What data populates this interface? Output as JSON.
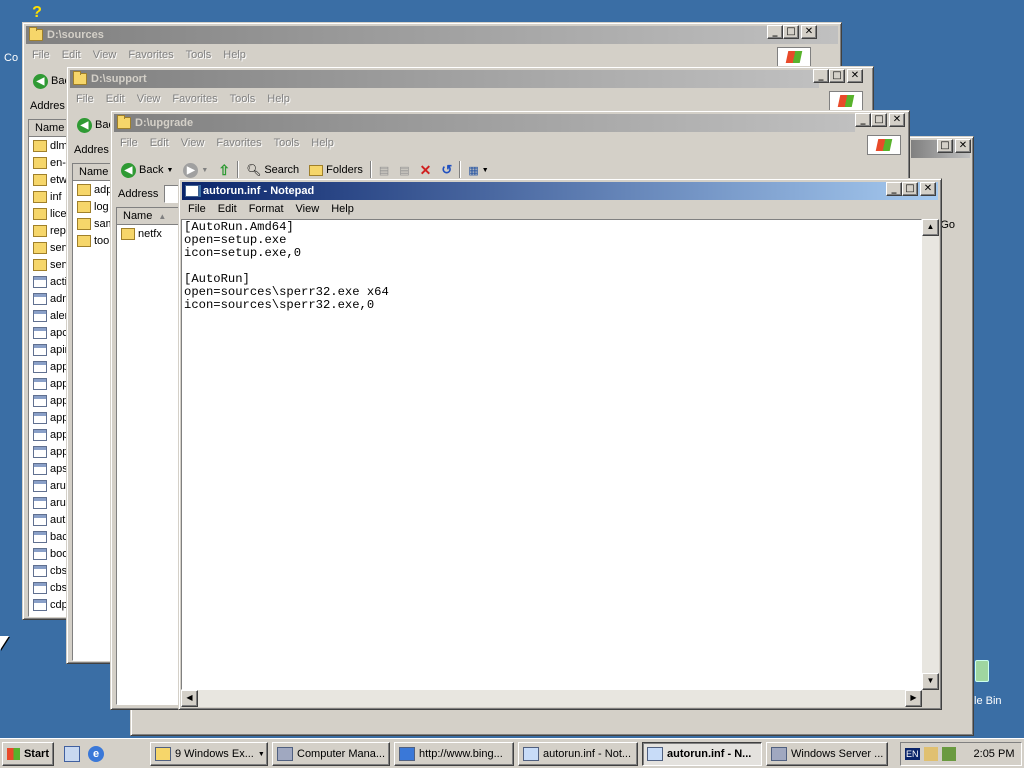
{
  "desktop": {
    "recycle_bin_label": "le Bin",
    "computer_label_fragment": "Co"
  },
  "win_sources": {
    "title": "D:\\sources",
    "menu": [
      "File",
      "Edit",
      "View",
      "Favorites",
      "Tools",
      "Help"
    ],
    "back_label": "Bac",
    "address_label": "Addres",
    "column_name": "Name",
    "files": [
      {
        "name": "dlm",
        "kind": "folder"
      },
      {
        "name": "en-",
        "kind": "folder"
      },
      {
        "name": "etw",
        "kind": "folder"
      },
      {
        "name": "inf",
        "kind": "folder"
      },
      {
        "name": "licer",
        "kind": "folder"
      },
      {
        "name": "rep",
        "kind": "folder"
      },
      {
        "name": "serv",
        "kind": "folder"
      },
      {
        "name": "serv",
        "kind": "folder"
      },
      {
        "name": "acti",
        "kind": "doc"
      },
      {
        "name": "adm",
        "kind": "doc"
      },
      {
        "name": "aler",
        "kind": "doc"
      },
      {
        "name": "apc",
        "kind": "doc"
      },
      {
        "name": "apir",
        "kind": "doc"
      },
      {
        "name": "app",
        "kind": "doc"
      },
      {
        "name": "app",
        "kind": "doc"
      },
      {
        "name": "app",
        "kind": "doc"
      },
      {
        "name": "app",
        "kind": "doc"
      },
      {
        "name": "app",
        "kind": "doc"
      },
      {
        "name": "app",
        "kind": "doc"
      },
      {
        "name": "aps",
        "kind": "doc"
      },
      {
        "name": "aru",
        "kind": "doc"
      },
      {
        "name": "aru",
        "kind": "doc"
      },
      {
        "name": "aut",
        "kind": "doc"
      },
      {
        "name": "bac",
        "kind": "doc"
      },
      {
        "name": "boo",
        "kind": "doc"
      },
      {
        "name": "cbs",
        "kind": "doc"
      },
      {
        "name": "cbs",
        "kind": "doc"
      },
      {
        "name": "cdp",
        "kind": "doc"
      }
    ]
  },
  "win_support": {
    "title": "D:\\support",
    "menu": [
      "File",
      "Edit",
      "View",
      "Favorites",
      "Tools",
      "Help"
    ],
    "back_label": "Bac",
    "address_label": "Addres",
    "column_name": "Name",
    "files": [
      {
        "name": "adp",
        "kind": "folder"
      },
      {
        "name": "log",
        "kind": "folder"
      },
      {
        "name": "sam",
        "kind": "folder"
      },
      {
        "name": "too",
        "kind": "folder"
      }
    ]
  },
  "win_upgrade": {
    "title": "D:\\upgrade",
    "menu": [
      "File",
      "Edit",
      "View",
      "Favorites",
      "Tools",
      "Help"
    ],
    "back_label": "Back",
    "search_label": "Search",
    "folders_label": "Folders",
    "address_label": "Address",
    "column_name": "Name",
    "files": [
      {
        "name": "netfx",
        "kind": "folder"
      }
    ]
  },
  "win_back": {
    "go_label": "Go"
  },
  "notepad": {
    "title": "autorun.inf - Notepad",
    "menu": [
      "File",
      "Edit",
      "Format",
      "View",
      "Help"
    ],
    "lines": [
      "[AutoRun.Amd64]",
      "open=setup.exe",
      "icon=setup.exe,0",
      "",
      "[AutoRun]",
      "open=sources\\sperr32.exe x64",
      "icon=sources\\sperr32.exe,0"
    ]
  },
  "taskbar": {
    "start_label": "Start",
    "tasks": [
      {
        "label": "9 Windows Ex...",
        "icon": "folder-icon",
        "pressed": false
      },
      {
        "label": "Computer Mana...",
        "icon": "computer-management-icon",
        "pressed": false
      },
      {
        "label": "http://www.bing...",
        "icon": "internet-explorer-icon",
        "pressed": false
      },
      {
        "label": "autorun.inf - Not...",
        "icon": "notepad-icon",
        "pressed": false
      },
      {
        "label": "autorun.inf - N...",
        "icon": "notepad-icon",
        "pressed": true
      },
      {
        "label": "Windows Server ...",
        "icon": "window-icon",
        "pressed": false
      }
    ],
    "language": "EN",
    "clock": "2:05 PM"
  }
}
